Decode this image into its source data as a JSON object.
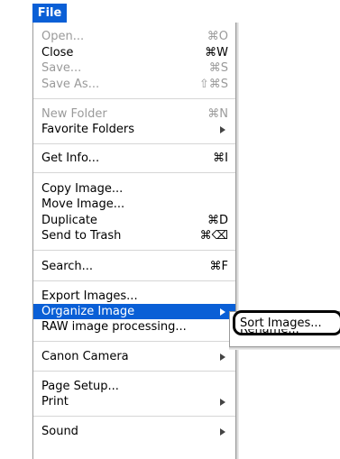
{
  "menu_title": "File",
  "items": [
    {
      "label": "Open...",
      "shortcut": "⌘O",
      "disabled": true
    },
    {
      "label": "Close",
      "shortcut": "⌘W",
      "disabled": false
    },
    {
      "label": "Save...",
      "shortcut": "⌘S",
      "disabled": true
    },
    {
      "label": "Save As...",
      "shortcut": "⇧⌘S",
      "disabled": true
    },
    {
      "label": "New Folder",
      "shortcut": "⌘N",
      "disabled": true
    },
    {
      "label": "Favorite Folders",
      "shortcut": "",
      "submenu": true
    },
    {
      "label": "Get Info...",
      "shortcut": "⌘I"
    },
    {
      "label": "Copy Image...",
      "shortcut": ""
    },
    {
      "label": "Move Image...",
      "shortcut": ""
    },
    {
      "label": "Duplicate",
      "shortcut": "⌘D"
    },
    {
      "label": "Send to Trash",
      "shortcut": "⌘⌫"
    },
    {
      "label": "Search...",
      "shortcut": "⌘F"
    },
    {
      "label": "Export Images...",
      "shortcut": ""
    },
    {
      "label": "Organize Image",
      "shortcut": "",
      "submenu": true,
      "highlighted": true
    },
    {
      "label": "RAW image processing...",
      "shortcut": ""
    },
    {
      "label": "Canon Camera",
      "shortcut": "",
      "submenu": true
    },
    {
      "label": "Page Setup...",
      "shortcut": ""
    },
    {
      "label": "Print",
      "shortcut": "",
      "submenu": true
    },
    {
      "label": "Sound",
      "shortcut": "",
      "submenu": true
    }
  ],
  "submenu": {
    "items": [
      {
        "label": "Sort Images..."
      },
      {
        "label": "Rename..."
      }
    ]
  }
}
